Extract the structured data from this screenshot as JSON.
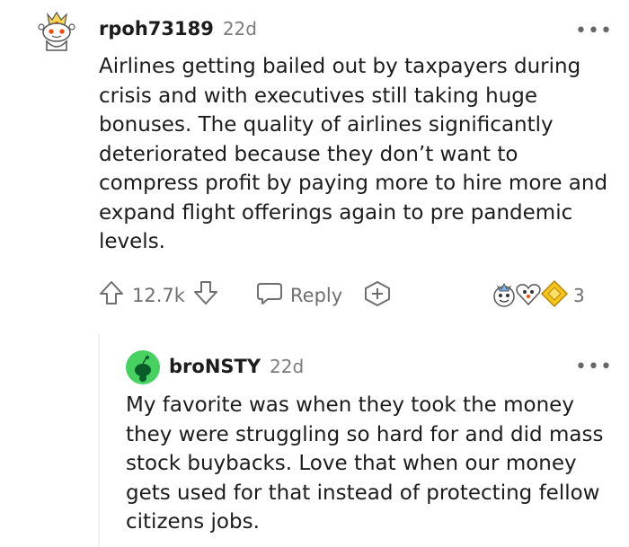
{
  "comments": [
    {
      "username": "rpoh73189",
      "age": "22d",
      "body": "Airlines getting bailed out by taxpayers during crisis and with executives still taking huge bonuses. The quality of airlines significantly deteriorated because they don’t want to compress profit by paying more to hire more and expand flight offerings again to pre pandemic levels.",
      "actions": {
        "score": "12.7k",
        "reply_label": "Reply",
        "award_count": "3"
      }
    },
    {
      "username": "broNSTY",
      "age": "22d",
      "body": "My favorite was when they took the money they were struggling so hard for and did mass stock buybacks. Love that when our money gets used for that instead of protecting fellow citizens jobs."
    }
  ],
  "more_icon_text": "•••",
  "colors": {
    "text": "#1c1c1c",
    "meta": "#7c7c7c",
    "icon": "#6f6f6f",
    "avatar_green": "#46d160",
    "award_gold": "#f5c518"
  }
}
